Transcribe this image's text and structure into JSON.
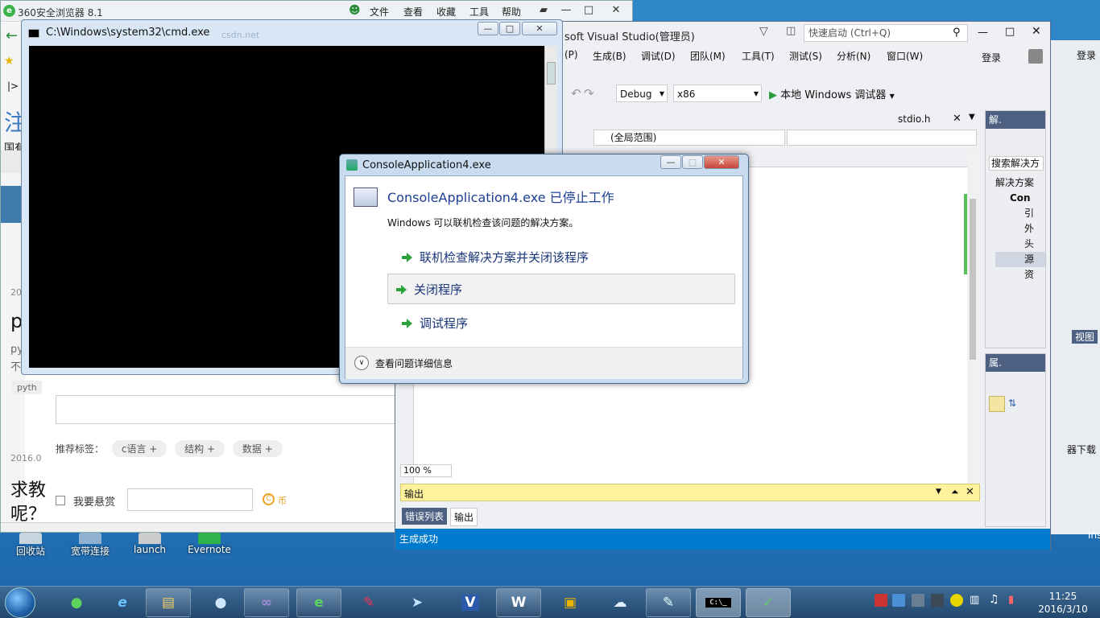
{
  "browser": {
    "title": "360安全浏览器 8.1",
    "menu": [
      "文件",
      "查看",
      "收藏",
      "工具",
      "帮助"
    ],
    "sidebar_fragments": [
      "注",
      "国有",
      "20",
      "p",
      "py",
      "不",
      "pyth",
      "2016.0",
      "求教",
      "呢？"
    ],
    "tags_label": "推荐标签：",
    "tags": [
      "c语言",
      "结构",
      "数据"
    ],
    "reward_label": "我要悬赏",
    "coin_label": "币",
    "tag_plus": "+"
  },
  "cmd": {
    "title": "C:\\Windows\\system32\\cmd.exe",
    "ghost_text": "csdn.net"
  },
  "dialog": {
    "title": "ConsoleApplication4.exe",
    "heading": "ConsoleApplication4.exe 已停止工作",
    "message": "Windows 可以联机检查该问题的解决方案。",
    "options": [
      "联机检查解决方案并关闭该程序",
      "关闭程序",
      "调试程序"
    ],
    "details": "查看问题详细信息"
  },
  "vs": {
    "title": "soft Visual Studio(管理员)",
    "quick_launch": "快速启动 (Ctrl+Q)",
    "login": "登录",
    "menu": [
      "(P)",
      "生成(B)",
      "调试(D)",
      "团队(M)",
      "工具(T)",
      "测试(S)",
      "分析(N)",
      "窗口(W)"
    ],
    "config": "Debug",
    "platform": "x86",
    "run": "本地 Windows 调试器",
    "doc_tab": "stdio.h",
    "scope": "(全局范围)",
    "zoom": "100 %",
    "output_title": "输出",
    "output_tabs": [
      "错误列表",
      "输出"
    ],
    "status": "生成成功",
    "solution_pane": {
      "title": "解.",
      "search": "搜索解决方",
      "items": [
        "解决方案",
        "Con",
        "引",
        "外",
        "头",
        "源",
        "资"
      ]
    },
    "props_pane": {
      "title": "属."
    }
  },
  "back_window": {
    "texts": [
      "登录",
      "视图",
      "器下载",
      "Ins"
    ]
  },
  "desktop_icons": [
    "回收站",
    "宽带连接",
    "launch",
    "Evernote"
  ],
  "taskbar": {
    "apps": [
      "360安全卫士",
      "Internet Explorer",
      "文件资源管理器",
      "Windows Media Player",
      "Visual Studio",
      "360安全浏览器",
      "涂鸦",
      "飞鸽",
      "Visio",
      "WPS",
      "书签",
      "云盘",
      "记事本",
      "命令提示符",
      "ConsoleApplication4"
    ],
    "cmd_icon_text": "C:\\_",
    "clock_time": "11:25",
    "clock_date": "2016/3/10"
  },
  "colors": {
    "vs_status": "#007acc",
    "output_header": "#fff29d",
    "dialog_heading": "#1c3f94"
  }
}
